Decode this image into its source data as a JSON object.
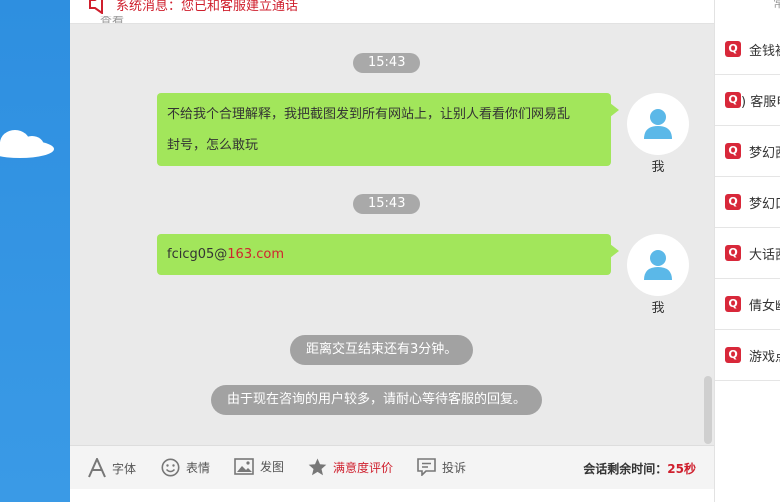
{
  "system_bar": {
    "message": "系统消息：您已和客服建立通话",
    "partial_text": "查看"
  },
  "messages": [
    {
      "time": "15:43",
      "text": "不给我个合理解释，我把截图发到所有网站上，让别人看看你们网易乱封号，怎么敢玩",
      "line1": "不给我个合理解释，我把截图发到所有网站上，让别人看看你们网易乱",
      "line2": "封号，怎么敢玩",
      "sender": "我"
    },
    {
      "time": "15:43",
      "text_prefix": "fcicg05@",
      "text_link": "163.com",
      "sender": "我"
    }
  ],
  "notices": [
    "距离交互结束还有3分钟。",
    "由于现在咨询的用户较多，请耐心等待客服的回复。"
  ],
  "toolbar": {
    "font": "字体",
    "emoji": "表情",
    "image": "发图",
    "rating": "满意度评价",
    "complaint": "投诉",
    "timer_label": "会话剩余时间：",
    "timer_value": "25秒"
  },
  "faq": {
    "top_partial": "常",
    "items": [
      {
        "label": "金钱被"
      },
      {
        "label": ") 客服电"
      },
      {
        "label": "梦幻西"
      },
      {
        "label": "梦幻口"
      },
      {
        "label": "大话西"
      },
      {
        "label": "倩女幽"
      },
      {
        "label": "游戏点"
      }
    ]
  },
  "colors": {
    "bubble": "#a2e65b",
    "brand_red": "#cf1f2d",
    "time_pill": "#a9a9a9",
    "avatar": "#5bb8e8"
  }
}
